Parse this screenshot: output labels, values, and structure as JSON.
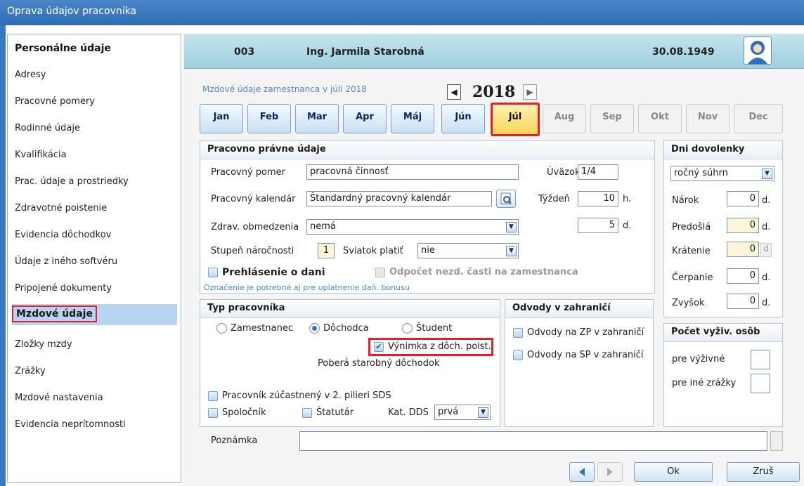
{
  "window": {
    "title": "Oprava údajov pracovníka"
  },
  "sidebar": {
    "heading": "Personálne údaje",
    "items": [
      "Adresy",
      "Pracovné pomery",
      "Rodinné údaje",
      "Kvalifikácia",
      "Prac. údaje a prostriedky",
      "Zdravotné poistenie",
      "Evidencia dôchodkov",
      "Údaje z iného softvéru",
      "Pripojené dokumenty"
    ],
    "active": "Mzdové údaje",
    "items_after": [
      "Zložky mzdy",
      "Zrážky",
      "Mzdové nastavenia",
      "Evidencia neprítomnosti"
    ]
  },
  "header": {
    "id": "003",
    "name": "Ing. Jarmila Starobná",
    "date": "30.08.1949"
  },
  "period": {
    "caption": "Mzdové údaje zamestnanca v júli 2018",
    "year": "2018",
    "prev_icon": "◀",
    "next_icon": "▶",
    "months": [
      "Jan",
      "Feb",
      "Mar",
      "Apr",
      "Máj",
      "Jún",
      "Júl",
      "Aug",
      "Sep",
      "Okt",
      "Nov",
      "Dec"
    ],
    "selected_month": "Júl"
  },
  "labor": {
    "title": "Pracovno právne údaje",
    "employment_label": "Pracovný pomer",
    "employment_value": "pracovná činnosť",
    "calendar_label": "Pracovný kalendár",
    "calendar_value": "Štandardný pracovný kalendár",
    "health_label": "Zdrav. obmedzenia",
    "health_value": "nemá",
    "difficulty_label": "Stupeň náročnosti",
    "difficulty_value": "1",
    "holiday_label": "Sviatok platiť",
    "holiday_value": "nie",
    "workload_label": "Úväzok",
    "workload_value": "1/4",
    "week_label": "Týždeň",
    "week_hours": "10",
    "hours_unit": "h.",
    "days_value": "5",
    "days_unit": "d.",
    "tax_decl_label": "Prehlásenie o dani",
    "tax_deduction_label": "Odpočet nezd. časti na zamestnanca",
    "tax_hint": "Označenie je potrebné aj pre uplatnenie daň. bonusu"
  },
  "worker_type": {
    "title": "Typ pracovníka",
    "options": [
      "Zamestnanec",
      "Dôchodca",
      "Študent"
    ],
    "selected": "Dôchodca",
    "exemption_label": "Výnimka z dôch. poist.",
    "pension_note": "Poberá starobný dôchodok",
    "pillar_label": "Pracovník zúčastnený v 2. pilieri SDS",
    "partner_label": "Spoločník",
    "statutory_label": "Štatutár",
    "dds_label": "Kat. DDS",
    "dds_value": "prvá"
  },
  "abroad": {
    "title": "Odvody v zahraničí",
    "zp_label": "Odvody na ZP v zahraničí",
    "sp_label": "Odvody na SP v zahraničí"
  },
  "vacation": {
    "title": "Dni dovolenky",
    "mode_value": "ročný súhrn",
    "rows": [
      {
        "label": "Nárok",
        "value": "0",
        "unit": "d."
      },
      {
        "label": "Predošlá",
        "value": "0",
        "unit": "d."
      },
      {
        "label": "Krátenie",
        "value": "0",
        "unit": "d"
      },
      {
        "label": "Čerpanie",
        "value": "0",
        "unit": "d."
      },
      {
        "label": "Zvyšok",
        "value": "0",
        "unit": "d."
      }
    ]
  },
  "dependents": {
    "title": "Počet vyživ. osôb",
    "support_label": "pre výživné",
    "other_label": "pre iné zrážky"
  },
  "note": {
    "label": "Poznámka",
    "value": ""
  },
  "footer": {
    "ok_label": "Ok",
    "cancel_label": "Zruš"
  }
}
